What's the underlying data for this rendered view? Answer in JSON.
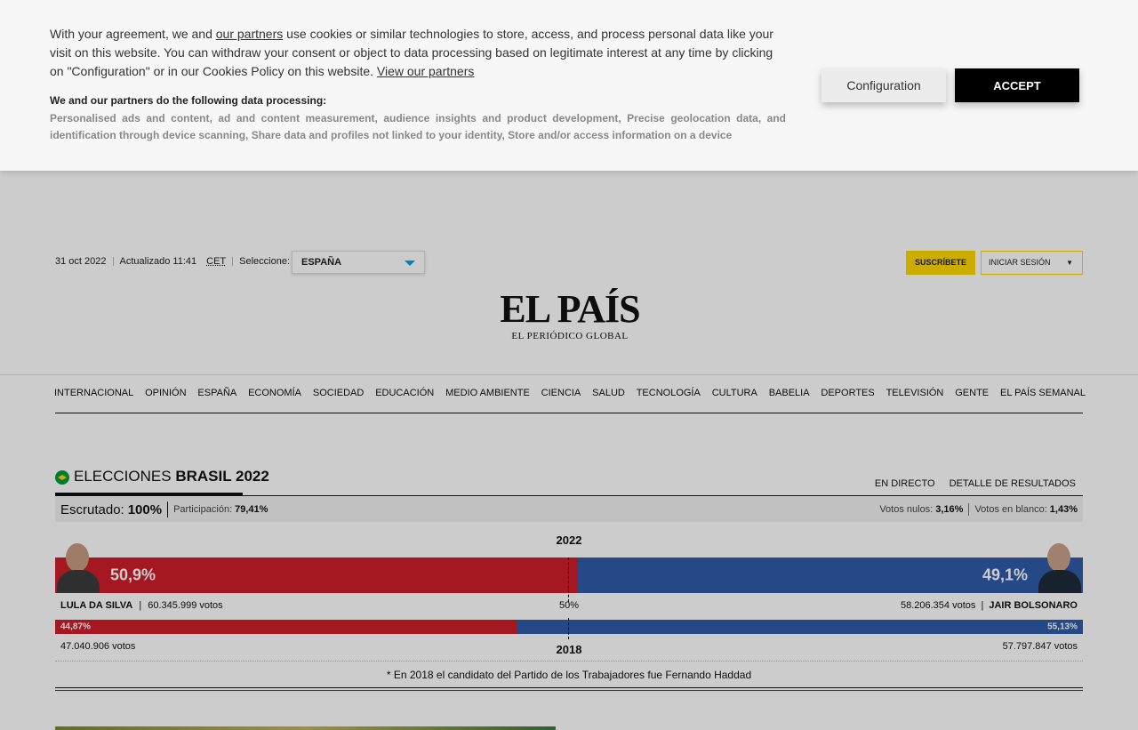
{
  "cookie_banner": {
    "text_part1": "With your agreement, we and",
    "partners_link": "our partners",
    "text_part2": "use cookies or similar technologies to store, access, and process personal data like your visit on this website. You can withdraw your consent or object to data processing based on legitimate interest at any time by clicking on \"Configuration\" or in our Cookies Policy on this website.",
    "view_partners_link": "View our partners",
    "processing_heading": "We and our partners do the following data processing:",
    "processing_list": "Personalised ads and content, ad and content measurement, audience insights and product development, Precise geolocation data, and identification through device scanning, Share data and profiles not linked to your identity, Store and/or access information on a device",
    "configuration_button": "Configuration",
    "accept_button": "ACCEPT"
  },
  "header": {
    "date": "31 oct 2022",
    "updated": "Actualizado 11:41",
    "timezone": "CET",
    "select_label": "Seleccione:",
    "edition": "ESPAÑA",
    "subscribe": "SUSCRÍBETE",
    "login": "INICIAR SESIÓN",
    "logo_name": "EL PAÍS",
    "logo_tagline": "EL PERIÓDICO GLOBAL"
  },
  "nav": {
    "items": [
      "INTERNACIONAL",
      "OPINIÓN",
      "ESPAÑA",
      "ECONOMÍA",
      "SOCIEDAD",
      "EDUCACIÓN",
      "MEDIO AMBIENTE",
      "CIENCIA",
      "SALUD",
      "TECNOLOGÍA",
      "CULTURA",
      "BABELIA",
      "DEPORTES",
      "TELEVISIÓN",
      "GENTE",
      "EL PAÍS SEMANAL"
    ]
  },
  "elections": {
    "title_light": "ELECCIONES",
    "title_bold": "BRASIL 2022",
    "link_live": "EN DIRECTO",
    "link_details": "DETALLE DE RESULTADOS",
    "counted_label": "Escrutado:",
    "counted_value": "100%",
    "turnout_label": "Participación:",
    "turnout_value": "79,41%",
    "null_label": "Votos nulos:",
    "null_value": "3,16%",
    "blank_label": "Votos en blanco:",
    "blank_value": "1,43%",
    "year_2022": "2022",
    "year_2018": "2018",
    "half_label": "50%",
    "lula_pct": "50,9%",
    "lula_share": 50.9,
    "bolsonaro_pct": "49,1%",
    "bolsonaro_share": 49.1,
    "lula_name": "LULA DA SILVA",
    "lula_votes": "60.345.999 votos",
    "bolsonaro_name": "JAIR BOLSONARO",
    "bolsonaro_votes": "58.206.354 votos",
    "pt_2018_pct": "44,87%",
    "pt_2018_share": 44.87,
    "bolsonaro_2018_pct": "55,13%",
    "bolsonaro_2018_share": 55.13,
    "pt_2018_votes": "47.040.906 votos",
    "bolsonaro_2018_votes": "57.797.847 votos",
    "note": "* En 2018 el candidato del Partido de los Trabajadores fue Fernando Haddad",
    "colors": {
      "red": "#cf1d2a",
      "blue": "#2f5aa8"
    }
  }
}
